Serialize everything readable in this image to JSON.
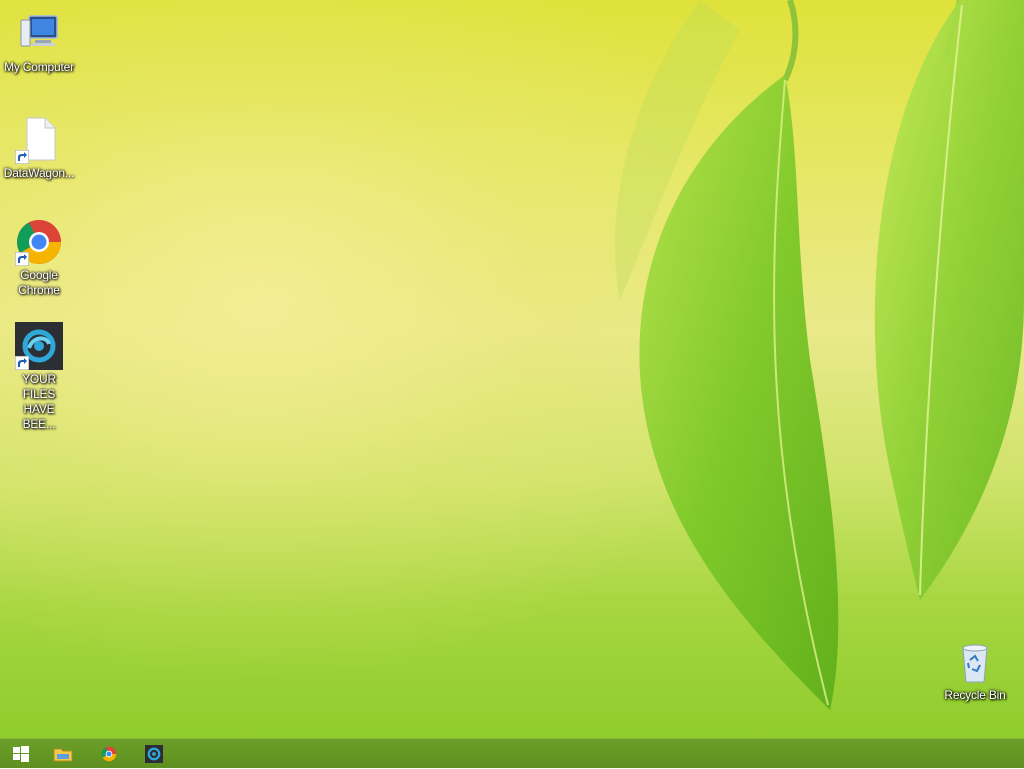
{
  "desktop": {
    "icons": [
      {
        "label": "My Computer",
        "icon": "computer-icon"
      },
      {
        "label": "DataWagon...",
        "icon": "document-icon"
      },
      {
        "label": "Google Chrome",
        "icon": "chrome-icon"
      },
      {
        "label": "YOUR FILES HAVE BEE...",
        "icon": "ransom-app-icon"
      },
      {
        "label": "Recycle Bin",
        "icon": "recycle-bin-icon"
      }
    ]
  },
  "taskbar": {
    "items": [
      {
        "icon": "windows-start-icon"
      },
      {
        "icon": "file-explorer-icon"
      },
      {
        "icon": "chrome-icon"
      },
      {
        "icon": "ransom-app-icon"
      }
    ]
  },
  "colors": {
    "taskbar": "#62932a",
    "wallpaper_top": "#dfe23a",
    "wallpaper_bottom": "#8fcc2c",
    "leaf": "#7cc828"
  }
}
